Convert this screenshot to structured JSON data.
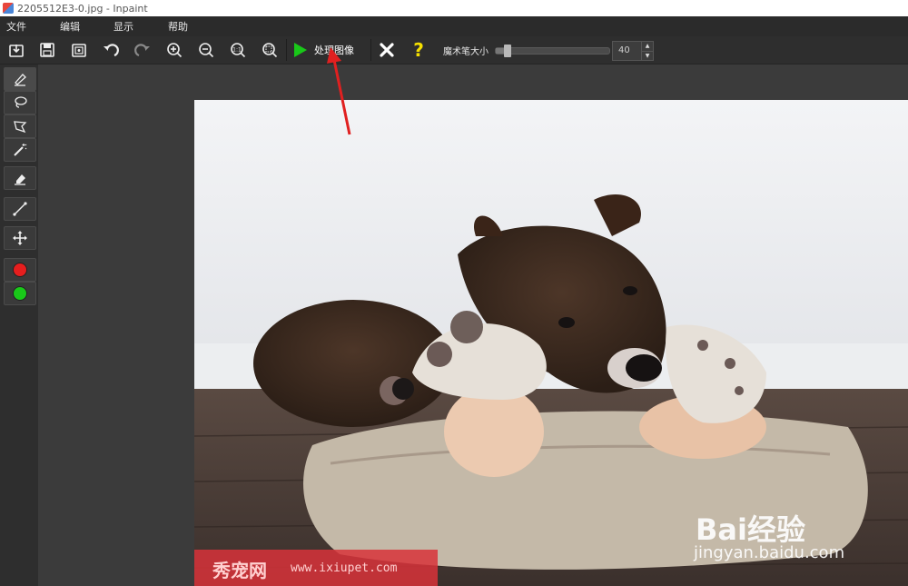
{
  "window": {
    "title": "2205512E3-0.jpg - Inpaint"
  },
  "menu": {
    "items": [
      "文件",
      "编辑",
      "显示",
      "帮助"
    ]
  },
  "toolbar": {
    "process_label": "处理图像",
    "brush_size_label": "魔术笔大小",
    "brush_size_value": "40",
    "brush_size_fraction": 0.1
  },
  "icons": [
    "open-icon",
    "save-icon",
    "save-as-icon",
    "undo-icon",
    "redo-icon",
    "zoom-in-icon",
    "zoom-out-icon",
    "actual-size-icon",
    "fit-icon",
    "play-icon",
    "close-icon",
    "help-icon"
  ],
  "left_tools": [
    "marker-icon",
    "lasso-icon",
    "polygonal-lasso-icon",
    "magic-wand-icon",
    "eraser-icon",
    "line-icon",
    "move-icon"
  ],
  "colors": {
    "play": "#19c819",
    "red_marker": "#e61e1e",
    "green_marker": "#19c819",
    "annotation_arrow": "#e02020",
    "help": "#f5e000"
  },
  "watermarks": {
    "baidu_brand": "Bai经验",
    "baidu_url": "jingyan.baidu.com",
    "xiuchong_brand": "秀宠网",
    "xiuchong_url": "www.ixiupet.com"
  }
}
